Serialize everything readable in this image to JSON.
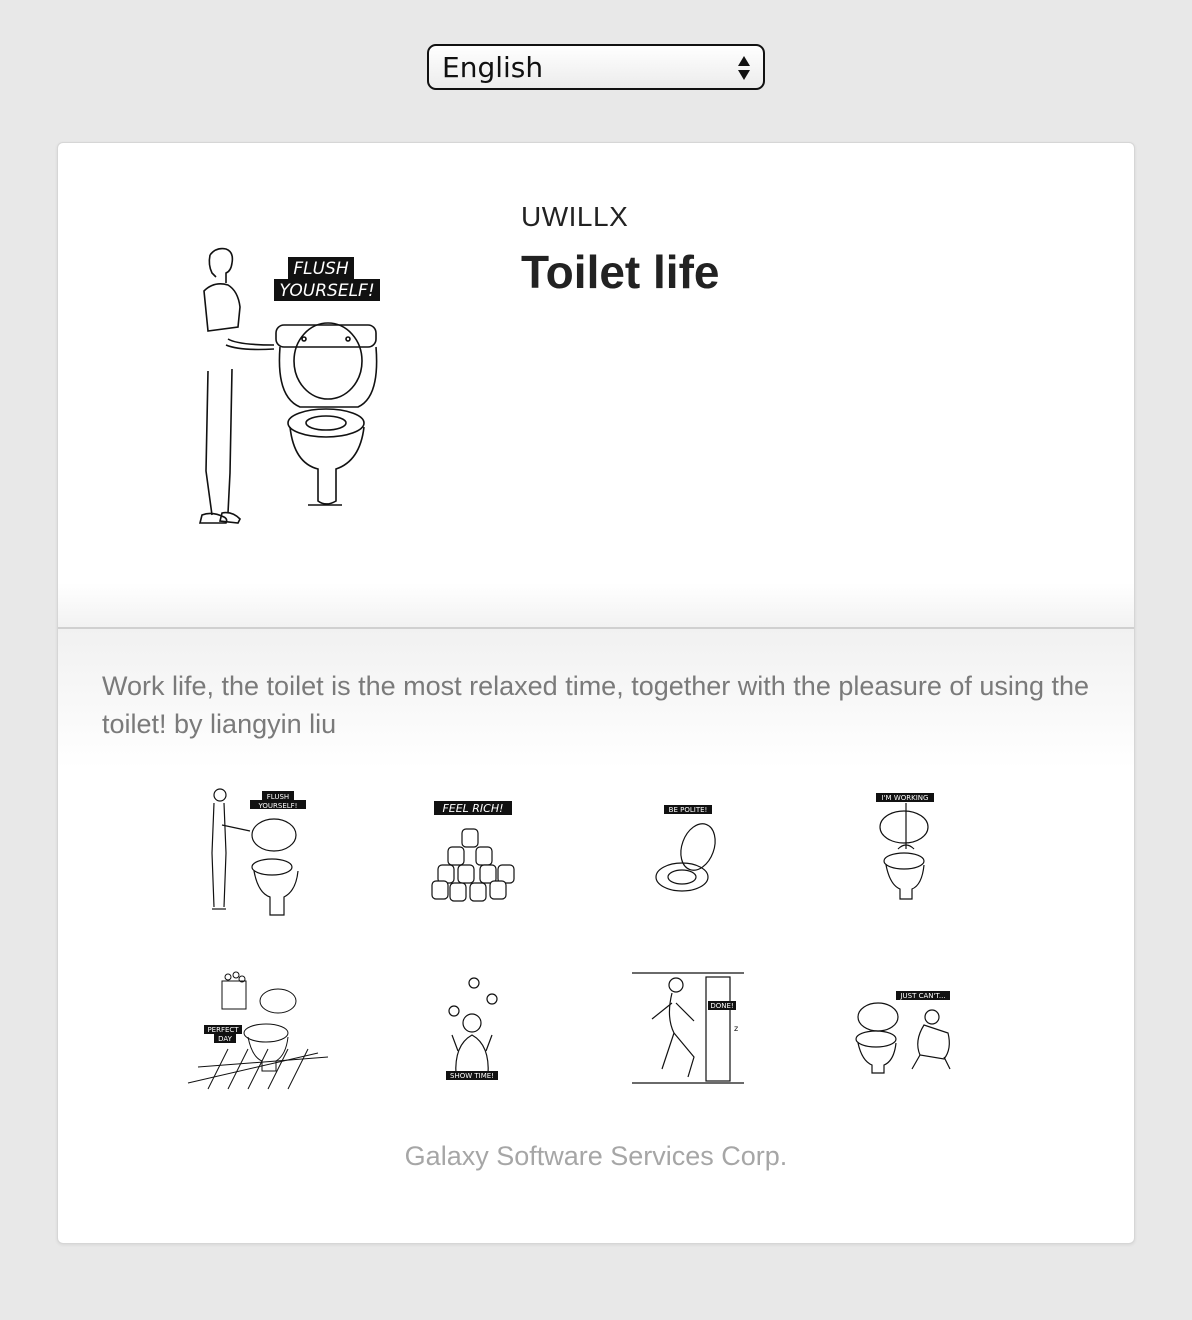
{
  "language_select": {
    "selected": "English",
    "arrow_icon": "updown-arrows-icon"
  },
  "product": {
    "author": "UWILLX",
    "title": "Toilet life",
    "hero_caption": [
      "FLUSH",
      "YOURSELF!"
    ],
    "description": "Work life, the toilet is the most relaxed time, together with the pleasure of using the toilet! by liangyin liu"
  },
  "stickers": [
    {
      "caption": "FLUSH YOURSELF!"
    },
    {
      "caption": "FEEL RICH!"
    },
    {
      "caption": "BE POLITE!"
    },
    {
      "caption": "I'M WORKING"
    },
    {
      "caption": "PERFECT DAY"
    },
    {
      "caption": "SHOW TIME!"
    },
    {
      "caption": "DONE!"
    },
    {
      "caption": "JUST CAN'T..."
    }
  ],
  "footer": {
    "company": "Galaxy Software Services Corp."
  }
}
